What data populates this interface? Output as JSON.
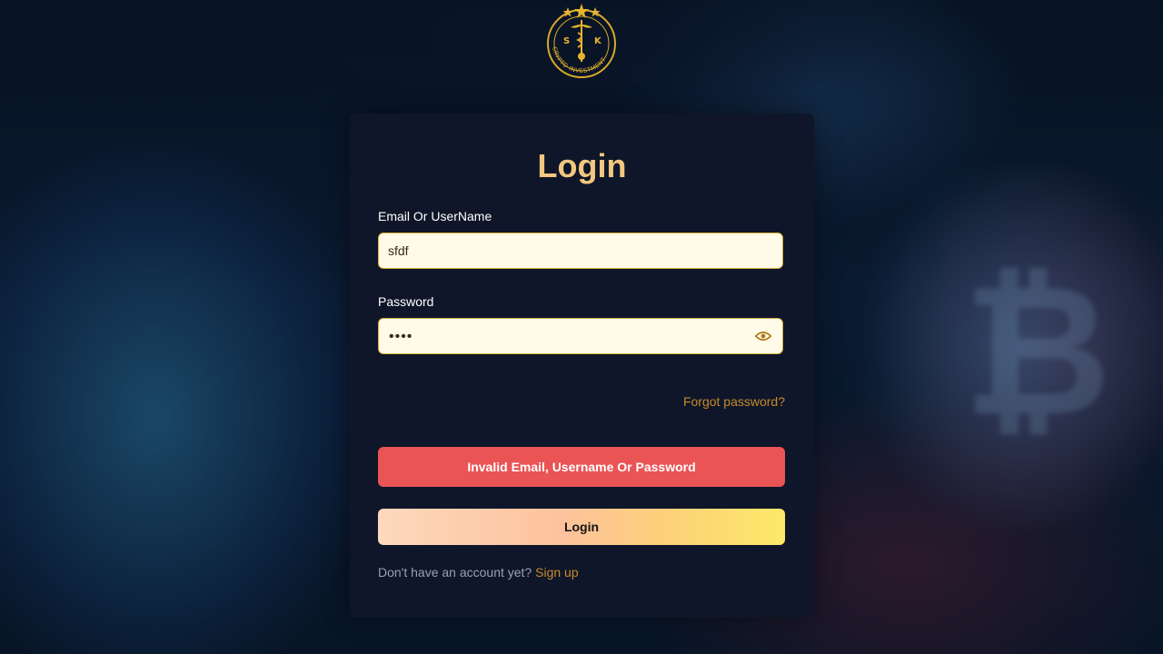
{
  "brand": {
    "logo_letters": [
      "S",
      "K"
    ],
    "logo_text": "CRYPTO INVESTMENT"
  },
  "login": {
    "title": "Login",
    "email_label": "Email Or UserName",
    "email_value": "sfdf",
    "password_label": "Password",
    "password_masked": "••••",
    "forgot_label": "Forgot password?",
    "error_message": "Invalid Email, Username Or Password",
    "submit_label": "Login",
    "signup_prompt": "Don't have an account yet?",
    "signup_link": "Sign up"
  },
  "icons": {
    "password_toggle": "eye-icon",
    "background_coin": "bitcoin-icon"
  },
  "colors": {
    "accent_gold": "#f2c77f",
    "link": "#c68a2c",
    "error": "#ea5455",
    "card": "#0f1629",
    "field_bg": "#fffbe8"
  }
}
